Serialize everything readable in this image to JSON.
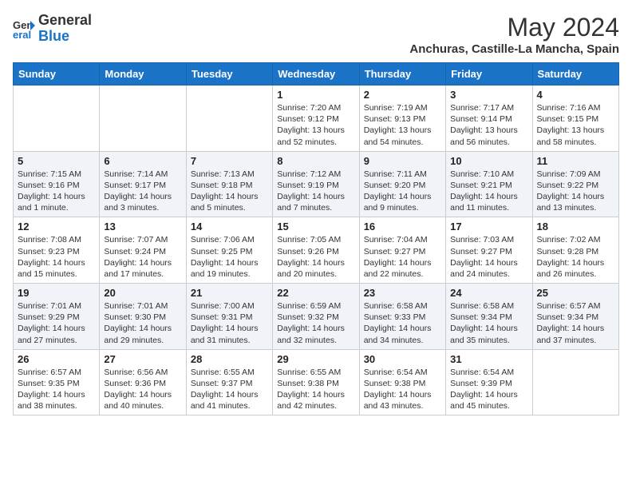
{
  "logo": {
    "line1": "General",
    "line2": "Blue"
  },
  "title": "May 2024",
  "location": "Anchuras, Castille-La Mancha, Spain",
  "days_of_week": [
    "Sunday",
    "Monday",
    "Tuesday",
    "Wednesday",
    "Thursday",
    "Friday",
    "Saturday"
  ],
  "weeks": [
    [
      {
        "day": "",
        "info": ""
      },
      {
        "day": "",
        "info": ""
      },
      {
        "day": "",
        "info": ""
      },
      {
        "day": "1",
        "info": "Sunrise: 7:20 AM\nSunset: 9:12 PM\nDaylight: 13 hours and 52 minutes."
      },
      {
        "day": "2",
        "info": "Sunrise: 7:19 AM\nSunset: 9:13 PM\nDaylight: 13 hours and 54 minutes."
      },
      {
        "day": "3",
        "info": "Sunrise: 7:17 AM\nSunset: 9:14 PM\nDaylight: 13 hours and 56 minutes."
      },
      {
        "day": "4",
        "info": "Sunrise: 7:16 AM\nSunset: 9:15 PM\nDaylight: 13 hours and 58 minutes."
      }
    ],
    [
      {
        "day": "5",
        "info": "Sunrise: 7:15 AM\nSunset: 9:16 PM\nDaylight: 14 hours and 1 minute."
      },
      {
        "day": "6",
        "info": "Sunrise: 7:14 AM\nSunset: 9:17 PM\nDaylight: 14 hours and 3 minutes."
      },
      {
        "day": "7",
        "info": "Sunrise: 7:13 AM\nSunset: 9:18 PM\nDaylight: 14 hours and 5 minutes."
      },
      {
        "day": "8",
        "info": "Sunrise: 7:12 AM\nSunset: 9:19 PM\nDaylight: 14 hours and 7 minutes."
      },
      {
        "day": "9",
        "info": "Sunrise: 7:11 AM\nSunset: 9:20 PM\nDaylight: 14 hours and 9 minutes."
      },
      {
        "day": "10",
        "info": "Sunrise: 7:10 AM\nSunset: 9:21 PM\nDaylight: 14 hours and 11 minutes."
      },
      {
        "day": "11",
        "info": "Sunrise: 7:09 AM\nSunset: 9:22 PM\nDaylight: 14 hours and 13 minutes."
      }
    ],
    [
      {
        "day": "12",
        "info": "Sunrise: 7:08 AM\nSunset: 9:23 PM\nDaylight: 14 hours and 15 minutes."
      },
      {
        "day": "13",
        "info": "Sunrise: 7:07 AM\nSunset: 9:24 PM\nDaylight: 14 hours and 17 minutes."
      },
      {
        "day": "14",
        "info": "Sunrise: 7:06 AM\nSunset: 9:25 PM\nDaylight: 14 hours and 19 minutes."
      },
      {
        "day": "15",
        "info": "Sunrise: 7:05 AM\nSunset: 9:26 PM\nDaylight: 14 hours and 20 minutes."
      },
      {
        "day": "16",
        "info": "Sunrise: 7:04 AM\nSunset: 9:27 PM\nDaylight: 14 hours and 22 minutes."
      },
      {
        "day": "17",
        "info": "Sunrise: 7:03 AM\nSunset: 9:27 PM\nDaylight: 14 hours and 24 minutes."
      },
      {
        "day": "18",
        "info": "Sunrise: 7:02 AM\nSunset: 9:28 PM\nDaylight: 14 hours and 26 minutes."
      }
    ],
    [
      {
        "day": "19",
        "info": "Sunrise: 7:01 AM\nSunset: 9:29 PM\nDaylight: 14 hours and 27 minutes."
      },
      {
        "day": "20",
        "info": "Sunrise: 7:01 AM\nSunset: 9:30 PM\nDaylight: 14 hours and 29 minutes."
      },
      {
        "day": "21",
        "info": "Sunrise: 7:00 AM\nSunset: 9:31 PM\nDaylight: 14 hours and 31 minutes."
      },
      {
        "day": "22",
        "info": "Sunrise: 6:59 AM\nSunset: 9:32 PM\nDaylight: 14 hours and 32 minutes."
      },
      {
        "day": "23",
        "info": "Sunrise: 6:58 AM\nSunset: 9:33 PM\nDaylight: 14 hours and 34 minutes."
      },
      {
        "day": "24",
        "info": "Sunrise: 6:58 AM\nSunset: 9:34 PM\nDaylight: 14 hours and 35 minutes."
      },
      {
        "day": "25",
        "info": "Sunrise: 6:57 AM\nSunset: 9:34 PM\nDaylight: 14 hours and 37 minutes."
      }
    ],
    [
      {
        "day": "26",
        "info": "Sunrise: 6:57 AM\nSunset: 9:35 PM\nDaylight: 14 hours and 38 minutes."
      },
      {
        "day": "27",
        "info": "Sunrise: 6:56 AM\nSunset: 9:36 PM\nDaylight: 14 hours and 40 minutes."
      },
      {
        "day": "28",
        "info": "Sunrise: 6:55 AM\nSunset: 9:37 PM\nDaylight: 14 hours and 41 minutes."
      },
      {
        "day": "29",
        "info": "Sunrise: 6:55 AM\nSunset: 9:38 PM\nDaylight: 14 hours and 42 minutes."
      },
      {
        "day": "30",
        "info": "Sunrise: 6:54 AM\nSunset: 9:38 PM\nDaylight: 14 hours and 43 minutes."
      },
      {
        "day": "31",
        "info": "Sunrise: 6:54 AM\nSunset: 9:39 PM\nDaylight: 14 hours and 45 minutes."
      },
      {
        "day": "",
        "info": ""
      }
    ]
  ]
}
